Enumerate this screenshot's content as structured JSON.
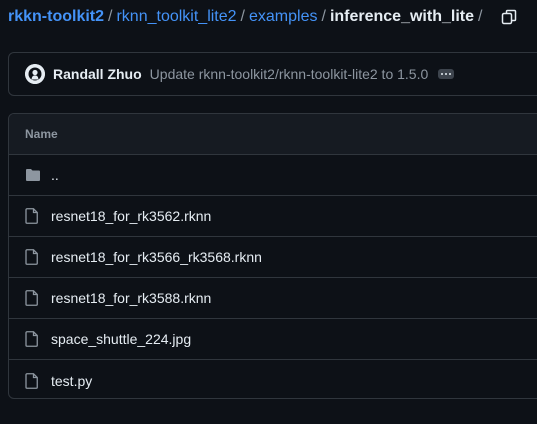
{
  "breadcrumb": {
    "root": "rkkn-toolkit2",
    "segments": [
      "rknn_toolkit_lite2",
      "examples"
    ],
    "current": "inference_with_lite",
    "separator": "/"
  },
  "commit": {
    "author": "Randall Zhuo",
    "message": "Update rknn-toolkit2/rknn-toolkit-lite2 to 1.5.0"
  },
  "table": {
    "header": "Name",
    "rows": [
      {
        "name": "..",
        "icon": "folder-icon"
      },
      {
        "name": "resnet18_for_rk3562.rknn",
        "icon": "file-icon"
      },
      {
        "name": "resnet18_for_rk3566_rk3568.rknn",
        "icon": "file-icon"
      },
      {
        "name": "resnet18_for_rk3588.rknn",
        "icon": "file-icon"
      },
      {
        "name": "space_shuttle_224.jpg",
        "icon": "file-icon"
      },
      {
        "name": "test.py",
        "icon": "file-icon"
      }
    ]
  },
  "colors": {
    "background": "#0d1117",
    "link": "#4493f8",
    "text": "#e6edf3",
    "muted": "#8d96a0",
    "border": "#30363d"
  }
}
